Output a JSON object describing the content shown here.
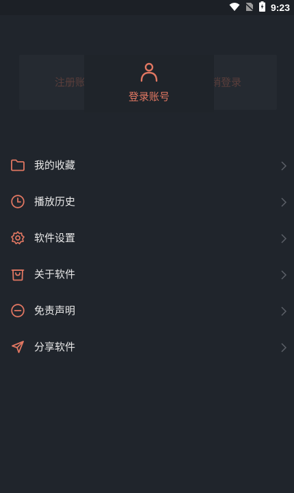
{
  "status": {
    "time": "9:23",
    "icons": [
      "wifi-icon",
      "no-sim-icon",
      "battery-charging-icon"
    ]
  },
  "header": {
    "ghost_left": "注册账",
    "ghost_right": "销登录",
    "login_label": "登录账号",
    "login_icon": "user-icon"
  },
  "menu": {
    "items": [
      {
        "label": "我的收藏",
        "icon": "folder-icon"
      },
      {
        "label": "播放历史",
        "icon": "clock-icon"
      },
      {
        "label": "软件设置",
        "icon": "gear-icon"
      },
      {
        "label": "关于软件",
        "icon": "bag-icon"
      },
      {
        "label": "免责声明",
        "icon": "minus-circle-icon"
      },
      {
        "label": "分享软件",
        "icon": "send-icon"
      }
    ]
  },
  "colors": {
    "accent": "#e17762",
    "background": "#20252c",
    "text": "#e8e8e8",
    "chevron": "#5c6068"
  }
}
